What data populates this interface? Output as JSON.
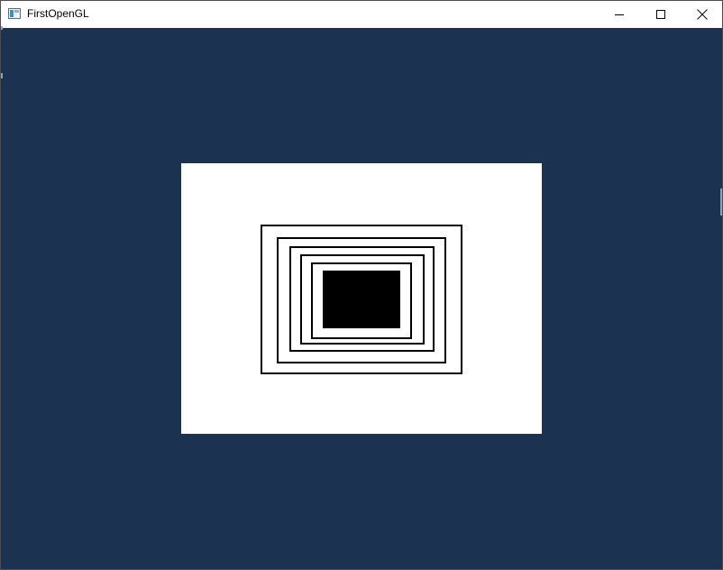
{
  "window": {
    "title": "FirstOpenGL",
    "icon": "app-window-icon",
    "controls": {
      "minimize_icon": "minimize-icon",
      "maximize_icon": "maximize-icon",
      "close_icon": "close-icon"
    }
  },
  "canvas": {
    "background_color": "#1b3350",
    "viewport_color": "#ffffff",
    "shape_color": "#000000",
    "nested_rectangles": 5,
    "filled_center_rectangle": true
  }
}
